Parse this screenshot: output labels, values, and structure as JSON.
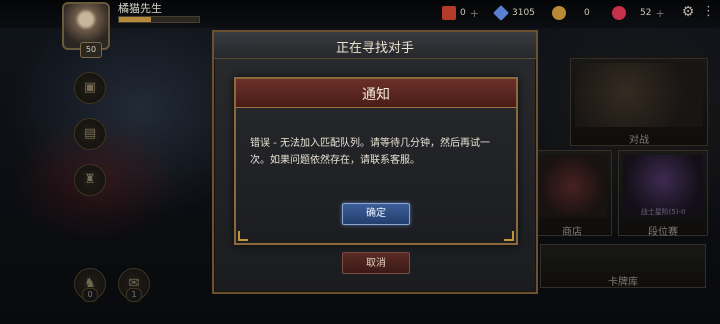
{
  "player": {
    "name": "橘猫先生",
    "level": "50"
  },
  "resources": [
    {
      "icon": "ticket-icon",
      "value": "0",
      "color": "#b43a2a"
    },
    {
      "icon": "crystal-icon",
      "value": "3105",
      "color": "#5a7fd1"
    },
    {
      "icon": "gold-coin-icon",
      "value": "0",
      "color": "#b88a34"
    },
    {
      "icon": "red-gem-icon",
      "value": "52",
      "color": "#c7304a"
    }
  ],
  "side_badges": {
    "bottom_left": "0",
    "bottom_right": "1"
  },
  "tiles": {
    "battle": "对战",
    "shop": "商店",
    "ranked": "段位赛",
    "ranked_sub": "战士星阶(5)-II",
    "card_library": "卡牌库"
  },
  "search_dialog": {
    "title": "正在寻找对手",
    "cancel_label": "取消"
  },
  "notice_dialog": {
    "title": "通知",
    "message": "错误 - 无法加入匹配队列。请等待几分钟，然后再试一次。如果问题依然存在，请联系客服。",
    "confirm_label": "确定"
  }
}
